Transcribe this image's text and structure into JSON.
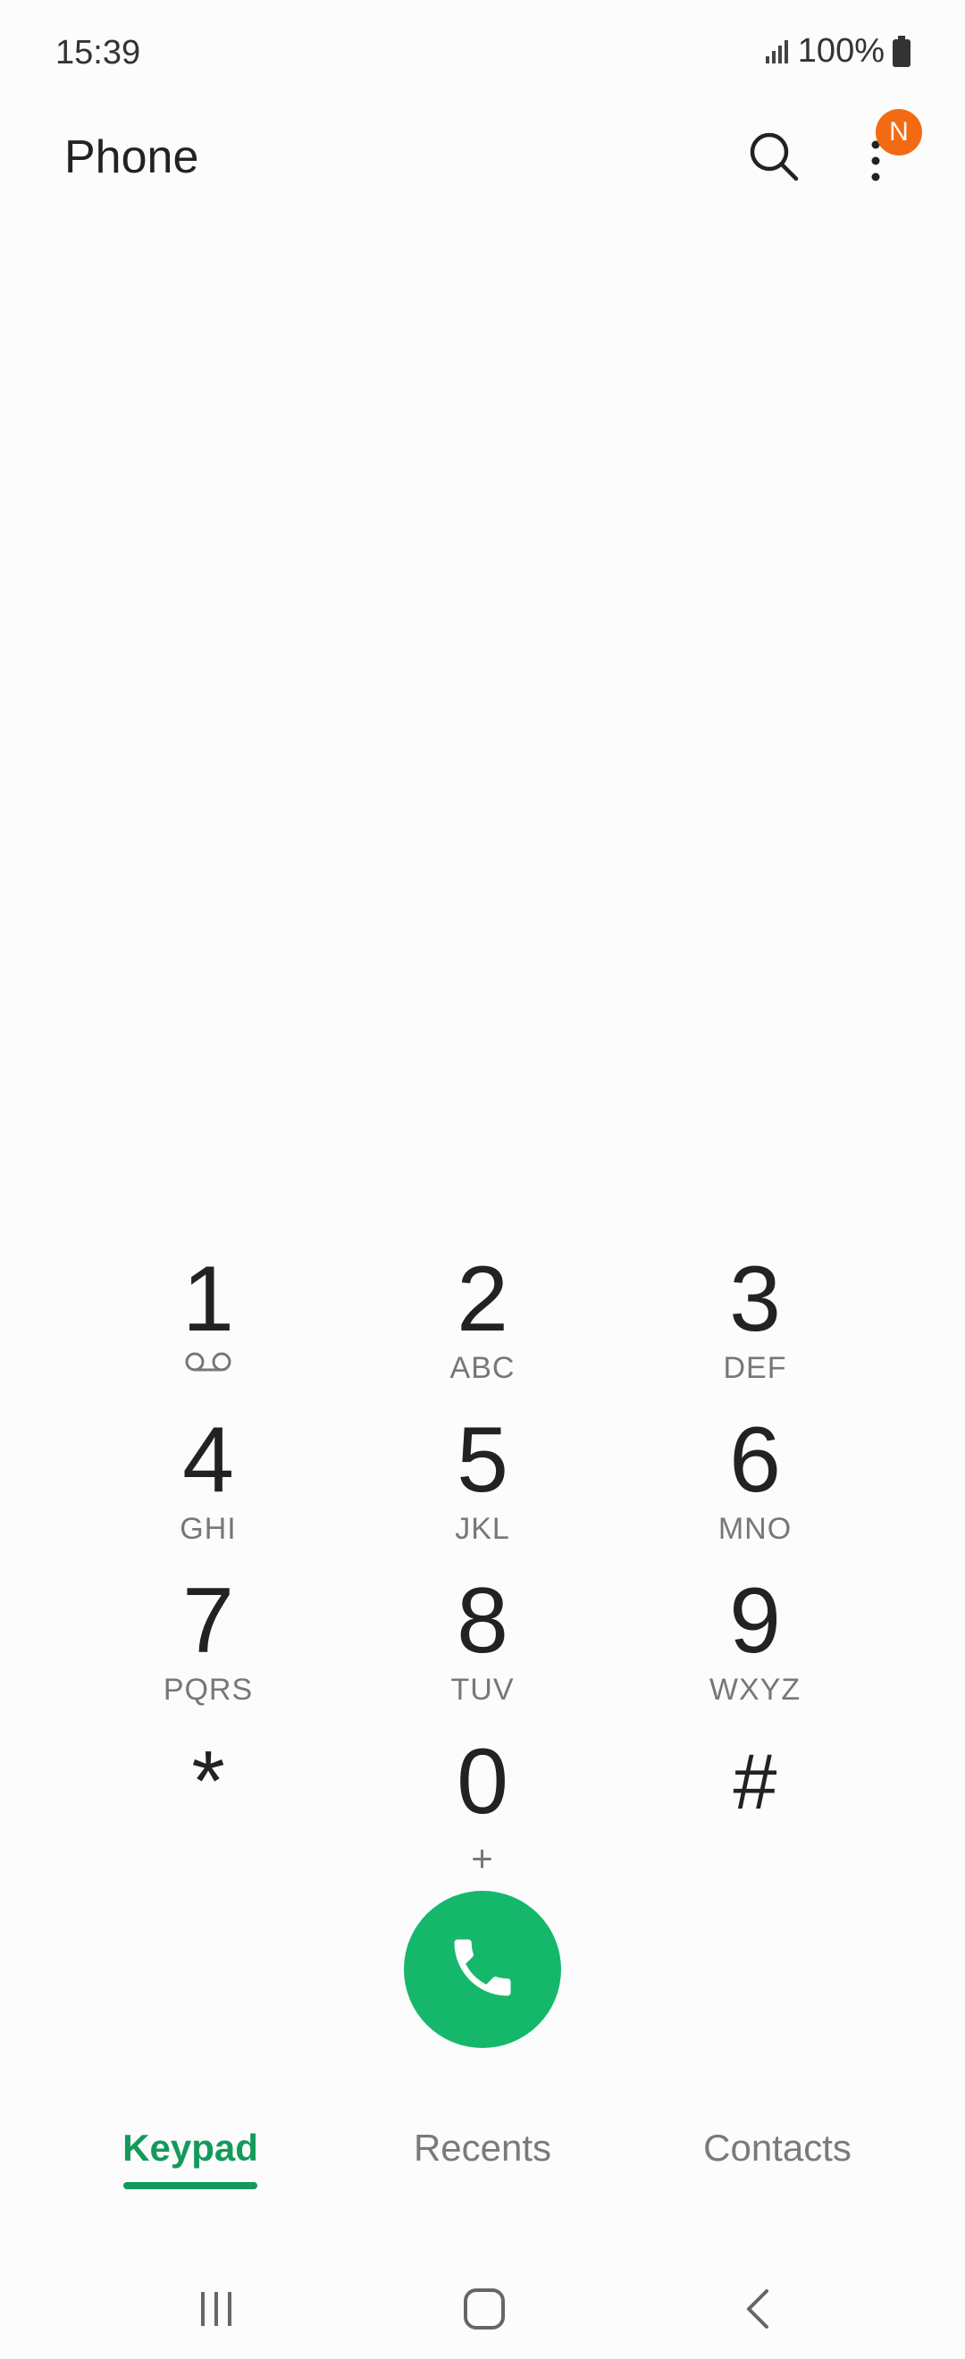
{
  "status_bar": {
    "time": "15:39",
    "battery": "100%"
  },
  "app_bar": {
    "title": "Phone",
    "notification_badge": "N"
  },
  "keypad": {
    "keys": [
      {
        "digit": "1",
        "letters": ""
      },
      {
        "digit": "2",
        "letters": "ABC"
      },
      {
        "digit": "3",
        "letters": "DEF"
      },
      {
        "digit": "4",
        "letters": "GHI"
      },
      {
        "digit": "5",
        "letters": "JKL"
      },
      {
        "digit": "6",
        "letters": "MNO"
      },
      {
        "digit": "7",
        "letters": "PQRS"
      },
      {
        "digit": "8",
        "letters": "TUV"
      },
      {
        "digit": "9",
        "letters": "WXYZ"
      },
      {
        "digit": "*",
        "letters": ""
      },
      {
        "digit": "0",
        "letters": "+"
      },
      {
        "digit": "#",
        "letters": ""
      }
    ]
  },
  "tabs": [
    {
      "label": "Keypad",
      "active": true
    },
    {
      "label": "Recents",
      "active": false
    },
    {
      "label": "Contacts",
      "active": false
    }
  ],
  "icons": {
    "signal": "signal-icon",
    "battery": "battery-icon",
    "search": "search-icon",
    "more": "more-vert-icon",
    "voicemail": "voicemail-icon",
    "call": "phone-icon",
    "recent_apps": "recent-apps-icon",
    "home": "home-icon",
    "back": "back-icon"
  },
  "colors": {
    "accent": "#139a5a",
    "call_button": "#15b86b",
    "badge": "#f26b13"
  }
}
